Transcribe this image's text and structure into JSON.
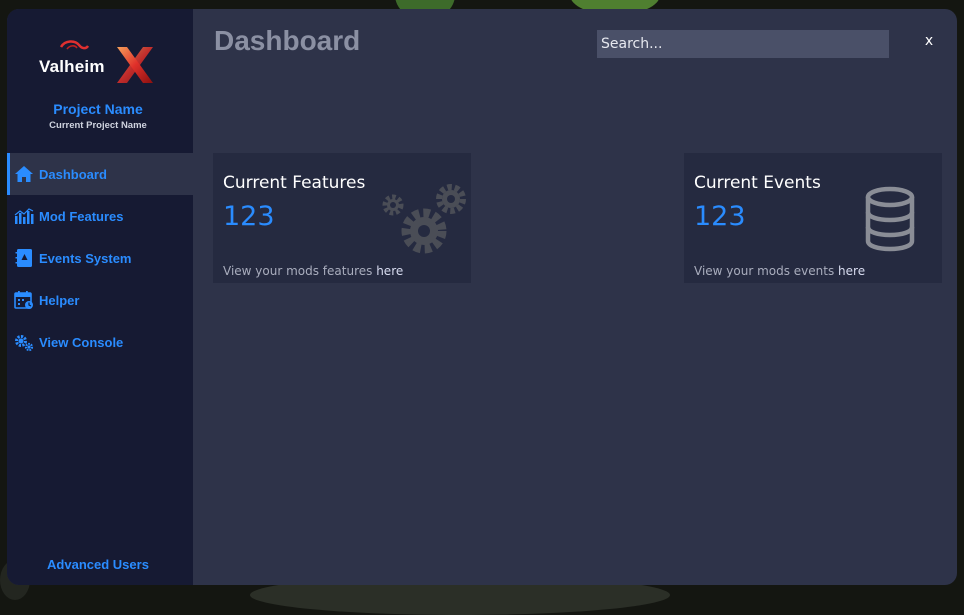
{
  "colors": {
    "accent": "#2a8cff",
    "window_bg": "#2e3349",
    "sidebar_bg": "#161a33",
    "card_bg": "#252a40",
    "search_bg": "#4a5068"
  },
  "sidebar": {
    "logo_text": "Valheim",
    "project_name": "Project Name",
    "project_sub": "Current Project Name",
    "items": [
      {
        "label": "Dashboard",
        "icon": "home-icon",
        "active": true
      },
      {
        "label": "Mod Features",
        "icon": "bar-chart-icon",
        "active": false
      },
      {
        "label": "Events System",
        "icon": "notebook-icon",
        "active": false
      },
      {
        "label": "Helper",
        "icon": "calendar-icon",
        "active": false
      },
      {
        "label": "View Console",
        "icon": "gears-icon",
        "active": false
      }
    ],
    "advanced_label": "Advanced Users"
  },
  "header": {
    "title": "Dashboard",
    "search_placeholder": "Search...",
    "close_label": "x"
  },
  "cards": [
    {
      "title": "Current Features",
      "value": "123",
      "foot_text": "View your mods features ",
      "foot_link": "here",
      "icon": "gears-icon"
    },
    {
      "title": "Current Events",
      "value": "123",
      "foot_text": "View your mods events ",
      "foot_link": "here",
      "icon": "database-icon"
    }
  ]
}
